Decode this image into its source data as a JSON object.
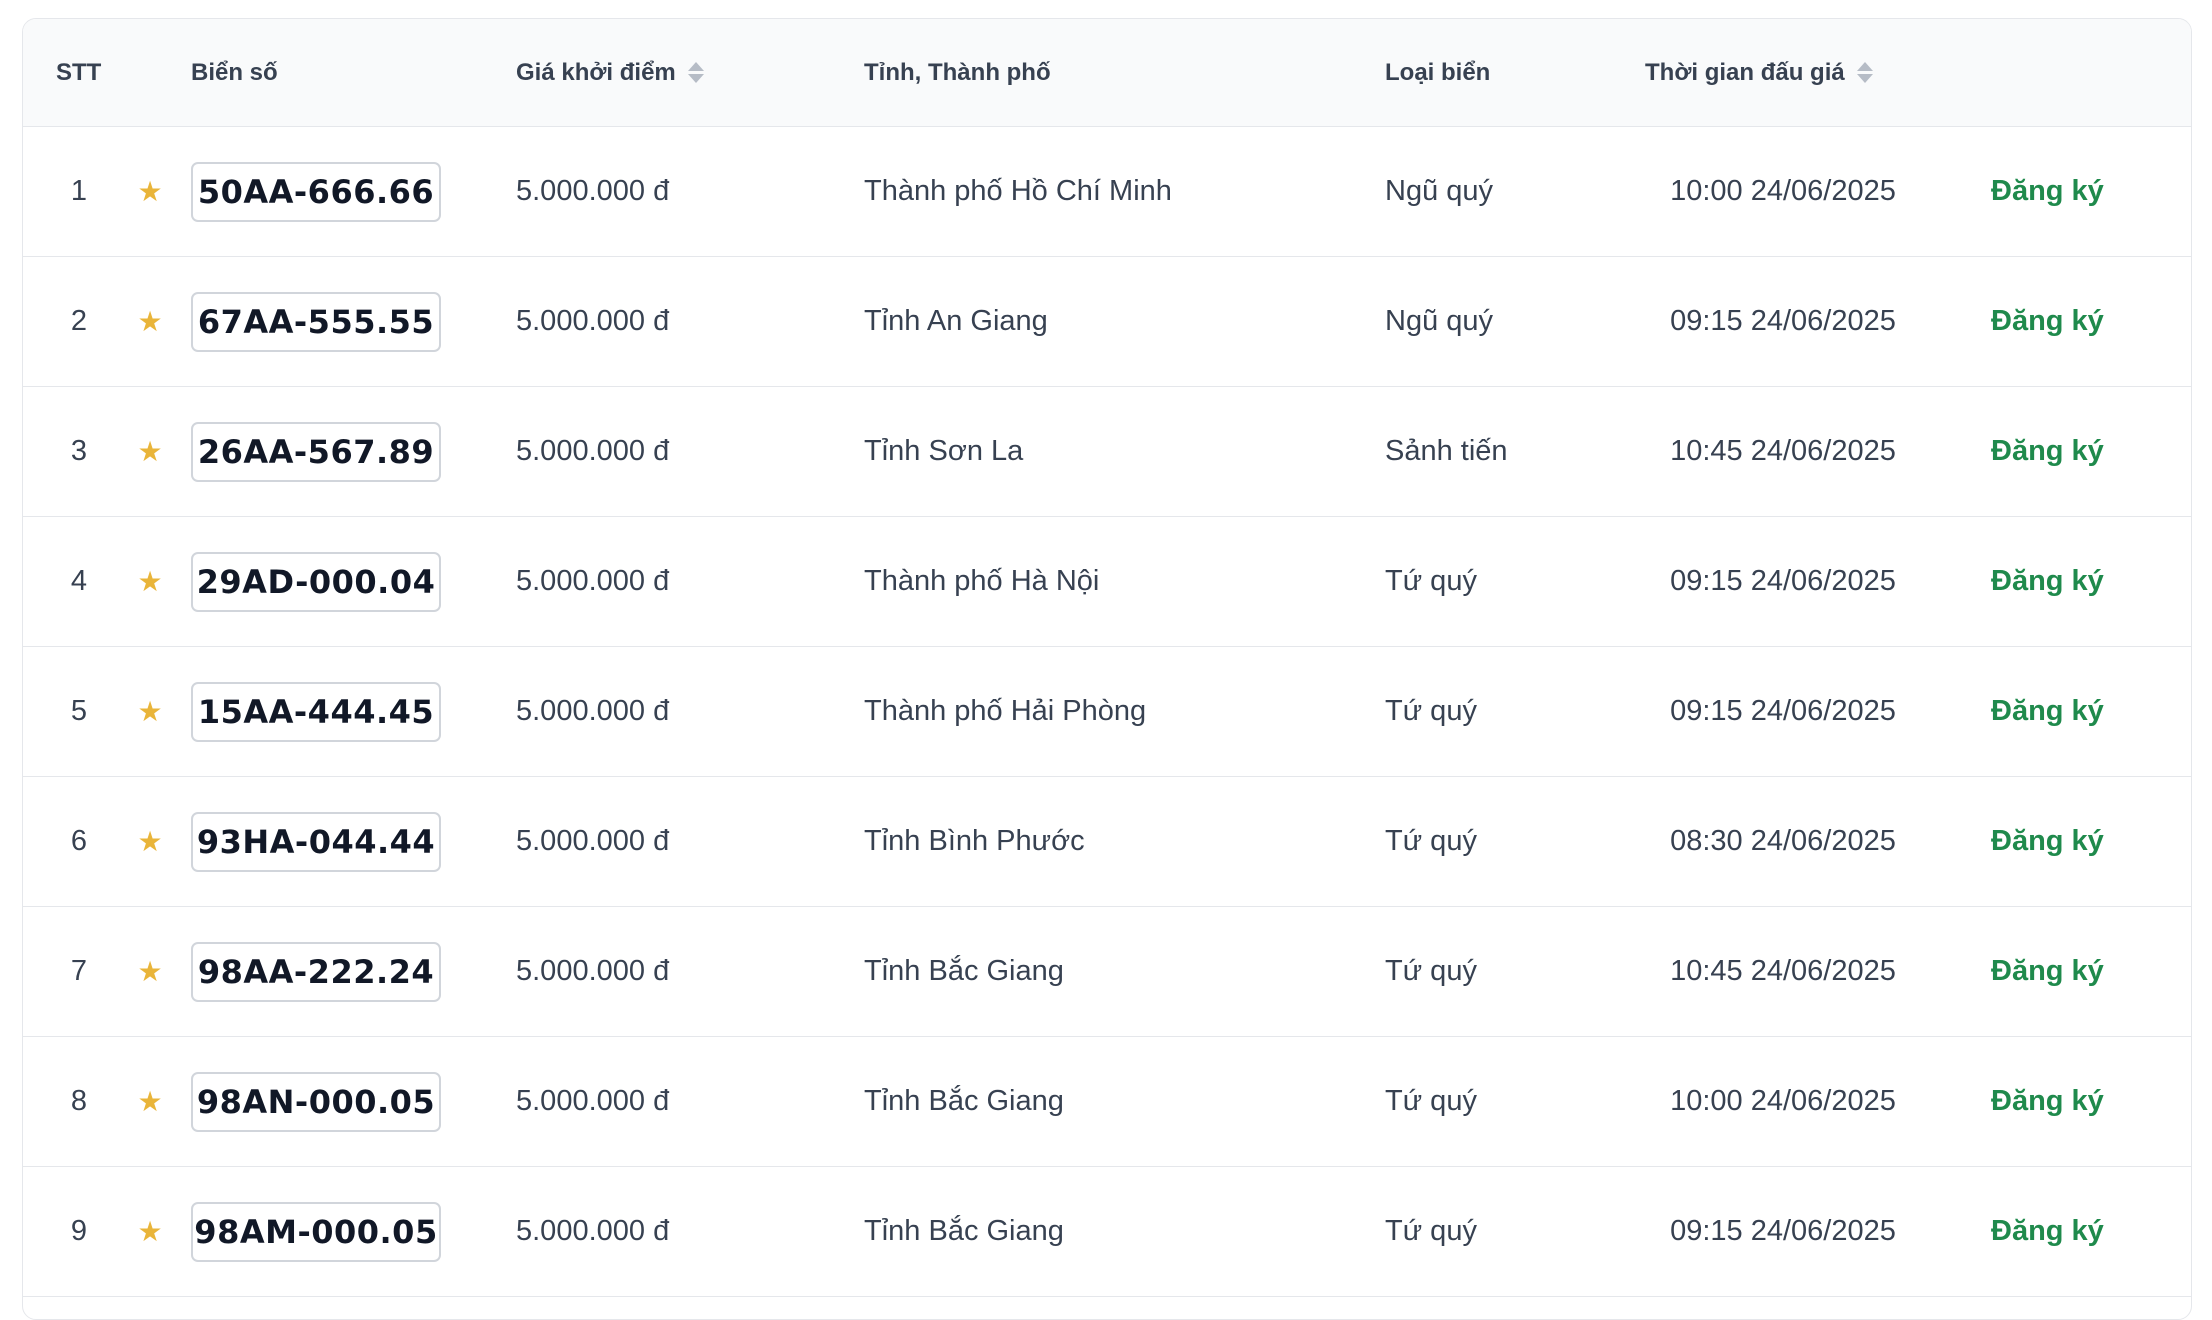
{
  "headers": {
    "stt": "STT",
    "plate": "Biển số",
    "price": "Giá khởi điểm",
    "province": "Tỉnh, Thành phố",
    "type": "Loại biển",
    "time": "Thời gian đấu giá"
  },
  "colors": {
    "accent_green": "#1f8a4c",
    "star_gold": "#e9b53a"
  },
  "rows": [
    {
      "stt": "1",
      "plate": "50AA-666.66",
      "price": "5.000.000 đ",
      "province": "Thành phố Hồ Chí Minh",
      "type": "Ngũ quý",
      "time": "10:00 24/06/2025",
      "action": "Đăng ký"
    },
    {
      "stt": "2",
      "plate": "67AA-555.55",
      "price": "5.000.000 đ",
      "province": "Tỉnh An Giang",
      "type": "Ngũ quý",
      "time": "09:15 24/06/2025",
      "action": "Đăng ký"
    },
    {
      "stt": "3",
      "plate": "26AA-567.89",
      "price": "5.000.000 đ",
      "province": "Tỉnh Sơn La",
      "type": "Sảnh tiến",
      "time": "10:45 24/06/2025",
      "action": "Đăng ký"
    },
    {
      "stt": "4",
      "plate": "29AD-000.04",
      "price": "5.000.000 đ",
      "province": "Thành phố Hà Nội",
      "type": "Tứ quý",
      "time": "09:15 24/06/2025",
      "action": "Đăng ký"
    },
    {
      "stt": "5",
      "plate": "15AA-444.45",
      "price": "5.000.000 đ",
      "province": "Thành phố Hải Phòng",
      "type": "Tứ quý",
      "time": "09:15 24/06/2025",
      "action": "Đăng ký"
    },
    {
      "stt": "6",
      "plate": "93HA-044.44",
      "price": "5.000.000 đ",
      "province": "Tỉnh Bình Phước",
      "type": "Tứ quý",
      "time": "08:30 24/06/2025",
      "action": "Đăng ký"
    },
    {
      "stt": "7",
      "plate": "98AA-222.24",
      "price": "5.000.000 đ",
      "province": "Tỉnh Bắc Giang",
      "type": "Tứ quý",
      "time": "10:45 24/06/2025",
      "action": "Đăng ký"
    },
    {
      "stt": "8",
      "plate": "98AN-000.05",
      "price": "5.000.000 đ",
      "province": "Tỉnh Bắc Giang",
      "type": "Tứ quý",
      "time": "10:00 24/06/2025",
      "action": "Đăng ký"
    },
    {
      "stt": "9",
      "plate": "98AM-000.05",
      "price": "5.000.000 đ",
      "province": "Tỉnh Bắc Giang",
      "type": "Tứ quý",
      "time": "09:15 24/06/2025",
      "action": "Đăng ký"
    }
  ]
}
